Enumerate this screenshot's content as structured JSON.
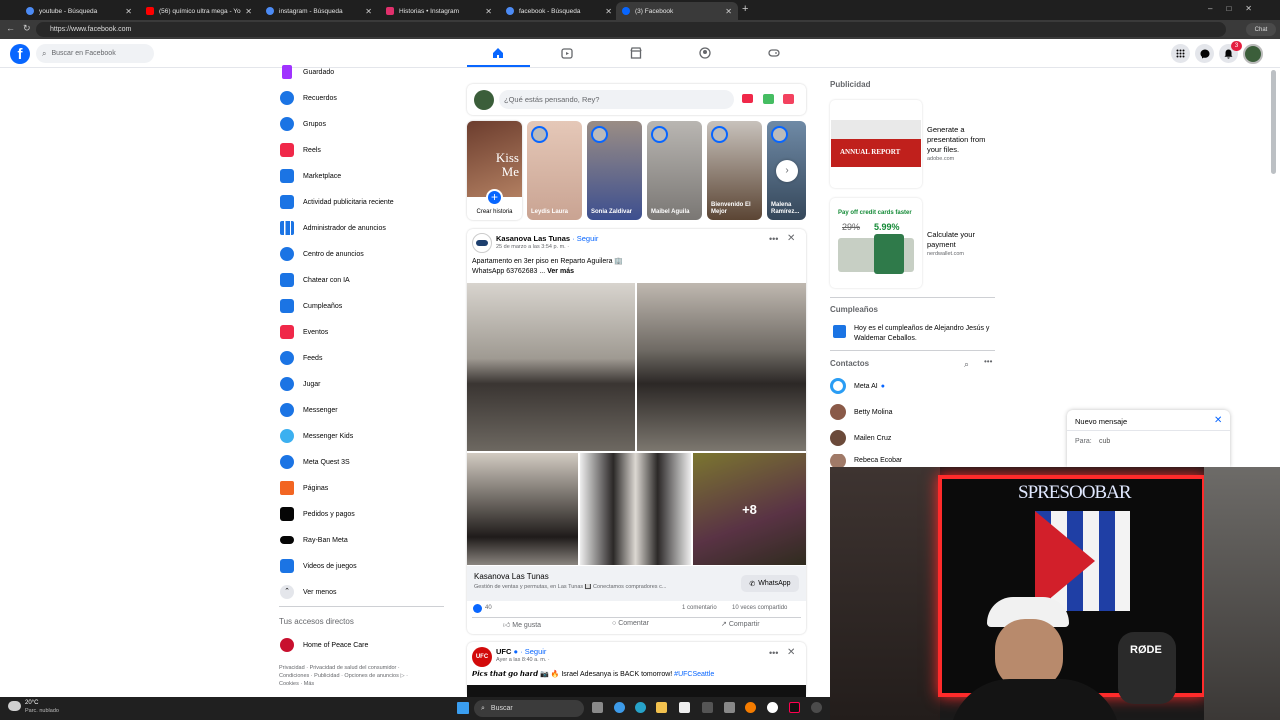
{
  "browser": {
    "tabs": [
      {
        "label": "youtube - Búsqueda",
        "color": "#4c8bf5"
      },
      {
        "label": "(56) químico ultra mega - YouTube",
        "color": "#ff0000"
      },
      {
        "label": "instagram - Búsqueda",
        "color": "#4c8bf5"
      },
      {
        "label": "Historias • Instagram",
        "color": "#e1306c"
      },
      {
        "label": "facebook - Búsqueda",
        "color": "#4c8bf5"
      },
      {
        "label": "(3) Facebook",
        "color": "#0866ff"
      }
    ],
    "url": "https://www.facebook.com",
    "chat_label": "Chat"
  },
  "header": {
    "search_placeholder": "Buscar en Facebook",
    "notification_count": "3"
  },
  "sidebar": {
    "items": [
      {
        "label": "Guardado",
        "color": "#a033ff"
      },
      {
        "label": "Recuerdos",
        "color": "#1b74e4"
      },
      {
        "label": "Grupos",
        "color": "#1b74e4"
      },
      {
        "label": "Reels",
        "color": "#f02849"
      },
      {
        "label": "Marketplace",
        "color": "#1b74e4"
      },
      {
        "label": "Actividad publicitaria reciente",
        "color": "#1b74e4"
      },
      {
        "label": "Administrador de anuncios",
        "color": "#1b74e4"
      },
      {
        "label": "Centro de anuncios",
        "color": "#1b74e4"
      },
      {
        "label": "Chatear con IA",
        "color": "#1b74e4"
      },
      {
        "label": "Cumpleaños",
        "color": "#1b74e4"
      },
      {
        "label": "Eventos",
        "color": "#f02849"
      },
      {
        "label": "Feeds",
        "color": "#1b74e4"
      },
      {
        "label": "Jugar",
        "color": "#1b74e4"
      },
      {
        "label": "Messenger",
        "color": "#1b74e4"
      },
      {
        "label": "Messenger Kids",
        "color": "#1b74e4"
      },
      {
        "label": "Meta Quest 3S",
        "color": "#1b74e4"
      },
      {
        "label": "Páginas",
        "color": "#f26522"
      },
      {
        "label": "Pedidos y pagos",
        "color": "#050505"
      },
      {
        "label": "Ray-Ban Meta",
        "color": "#050505"
      },
      {
        "label": "Videos de juegos",
        "color": "#1b74e4"
      }
    ],
    "see_less": "Ver menos",
    "shortcuts_title": "Tus accesos directos",
    "shortcut": "Home of Peace Care",
    "footer1": "Privacidad · Privacidad de salud del consumidor ·",
    "footer2": "Condiciones · Publicidad · Opciones de anuncios ▷ ·",
    "footer3": "Cookies · Más"
  },
  "composer": {
    "placeholder": "¿Qué estás pensando, Rey?"
  },
  "stories": [
    {
      "name": "Crear historia",
      "color": "#7a4a3a"
    },
    {
      "name": "Leydis Laura",
      "color": "#d9b8a8"
    },
    {
      "name": "Sonia Zaldivar",
      "color": "#8a7d78"
    },
    {
      "name": "Maibel Aguila",
      "color": "#a6a3a0"
    },
    {
      "name": "Bienvenido El Mejor",
      "color": "#5b4534"
    },
    {
      "name": "Malena Ramírez...",
      "color": "#4f6b86"
    }
  ],
  "post1": {
    "author": "Kasanova Las Tunas",
    "follow": "· Seguir",
    "time": "25 de marzo a las 3:54 p. m. ·",
    "text1": "Apartamento en 3er piso en Reparto Aguilera 🏢",
    "text2": "WhatsApp  63762683  ...",
    "see_more": "Ver más",
    "more_photos": "+8",
    "cta_title": "Kasanova Las Tunas",
    "cta_sub": "Gestión de ventas y permutas, en Las Tunas 🔲 Conectamos compradores c...",
    "cta_button": "WhatsApp",
    "likes": "40",
    "comments": "1 comentario",
    "shares": "10 veces compartido",
    "like": "Me gusta",
    "comment": "Comentar",
    "share": "Compartir"
  },
  "post2": {
    "author": "UFC",
    "follow": "· Seguir",
    "time": "Ayer a las 8:40 a. m. ·",
    "text": "𝙋𝙞𝙘𝙨 𝙩𝙝𝙖𝙩 𝙜𝙤 𝙝𝙖𝙧𝙙 📷 🔥 Israel Adesanya is BACK tomorrow!",
    "hashtag": "#UFCSeattle"
  },
  "right": {
    "ads_title": "Publicidad",
    "ad1_title": "Generate a presentation from your files.",
    "ad1_domain": "adobe.com",
    "ad1_img_text": "ANNUAL REPORT",
    "ad2_title": "Calculate your payment",
    "ad2_domain": "nerdwallet.com",
    "ad2_img_head": "Pay off credit cards faster",
    "ad2_rate1": "29%",
    "ad2_rate2": "5.99%",
    "birthdays_title": "Cumpleaños",
    "birthday_text": "Hoy es el cumpleaños de Alejandro Jesús y Waldemar Ceballos.",
    "contacts_title": "Contactos",
    "contacts": [
      "Meta AI",
      "Betty Molina",
      "Mailen Cruz",
      "Rebeca Ecobar"
    ]
  },
  "new_message": {
    "title": "Nuevo mensaje",
    "to_label": "Para:",
    "to_value": "cub"
  },
  "taskbar": {
    "temp": "20°C",
    "weather": "Parc. nublado",
    "search": "Buscar"
  },
  "webcam": {
    "sign": "SPRESOOBAR",
    "mic": "RØDE"
  }
}
